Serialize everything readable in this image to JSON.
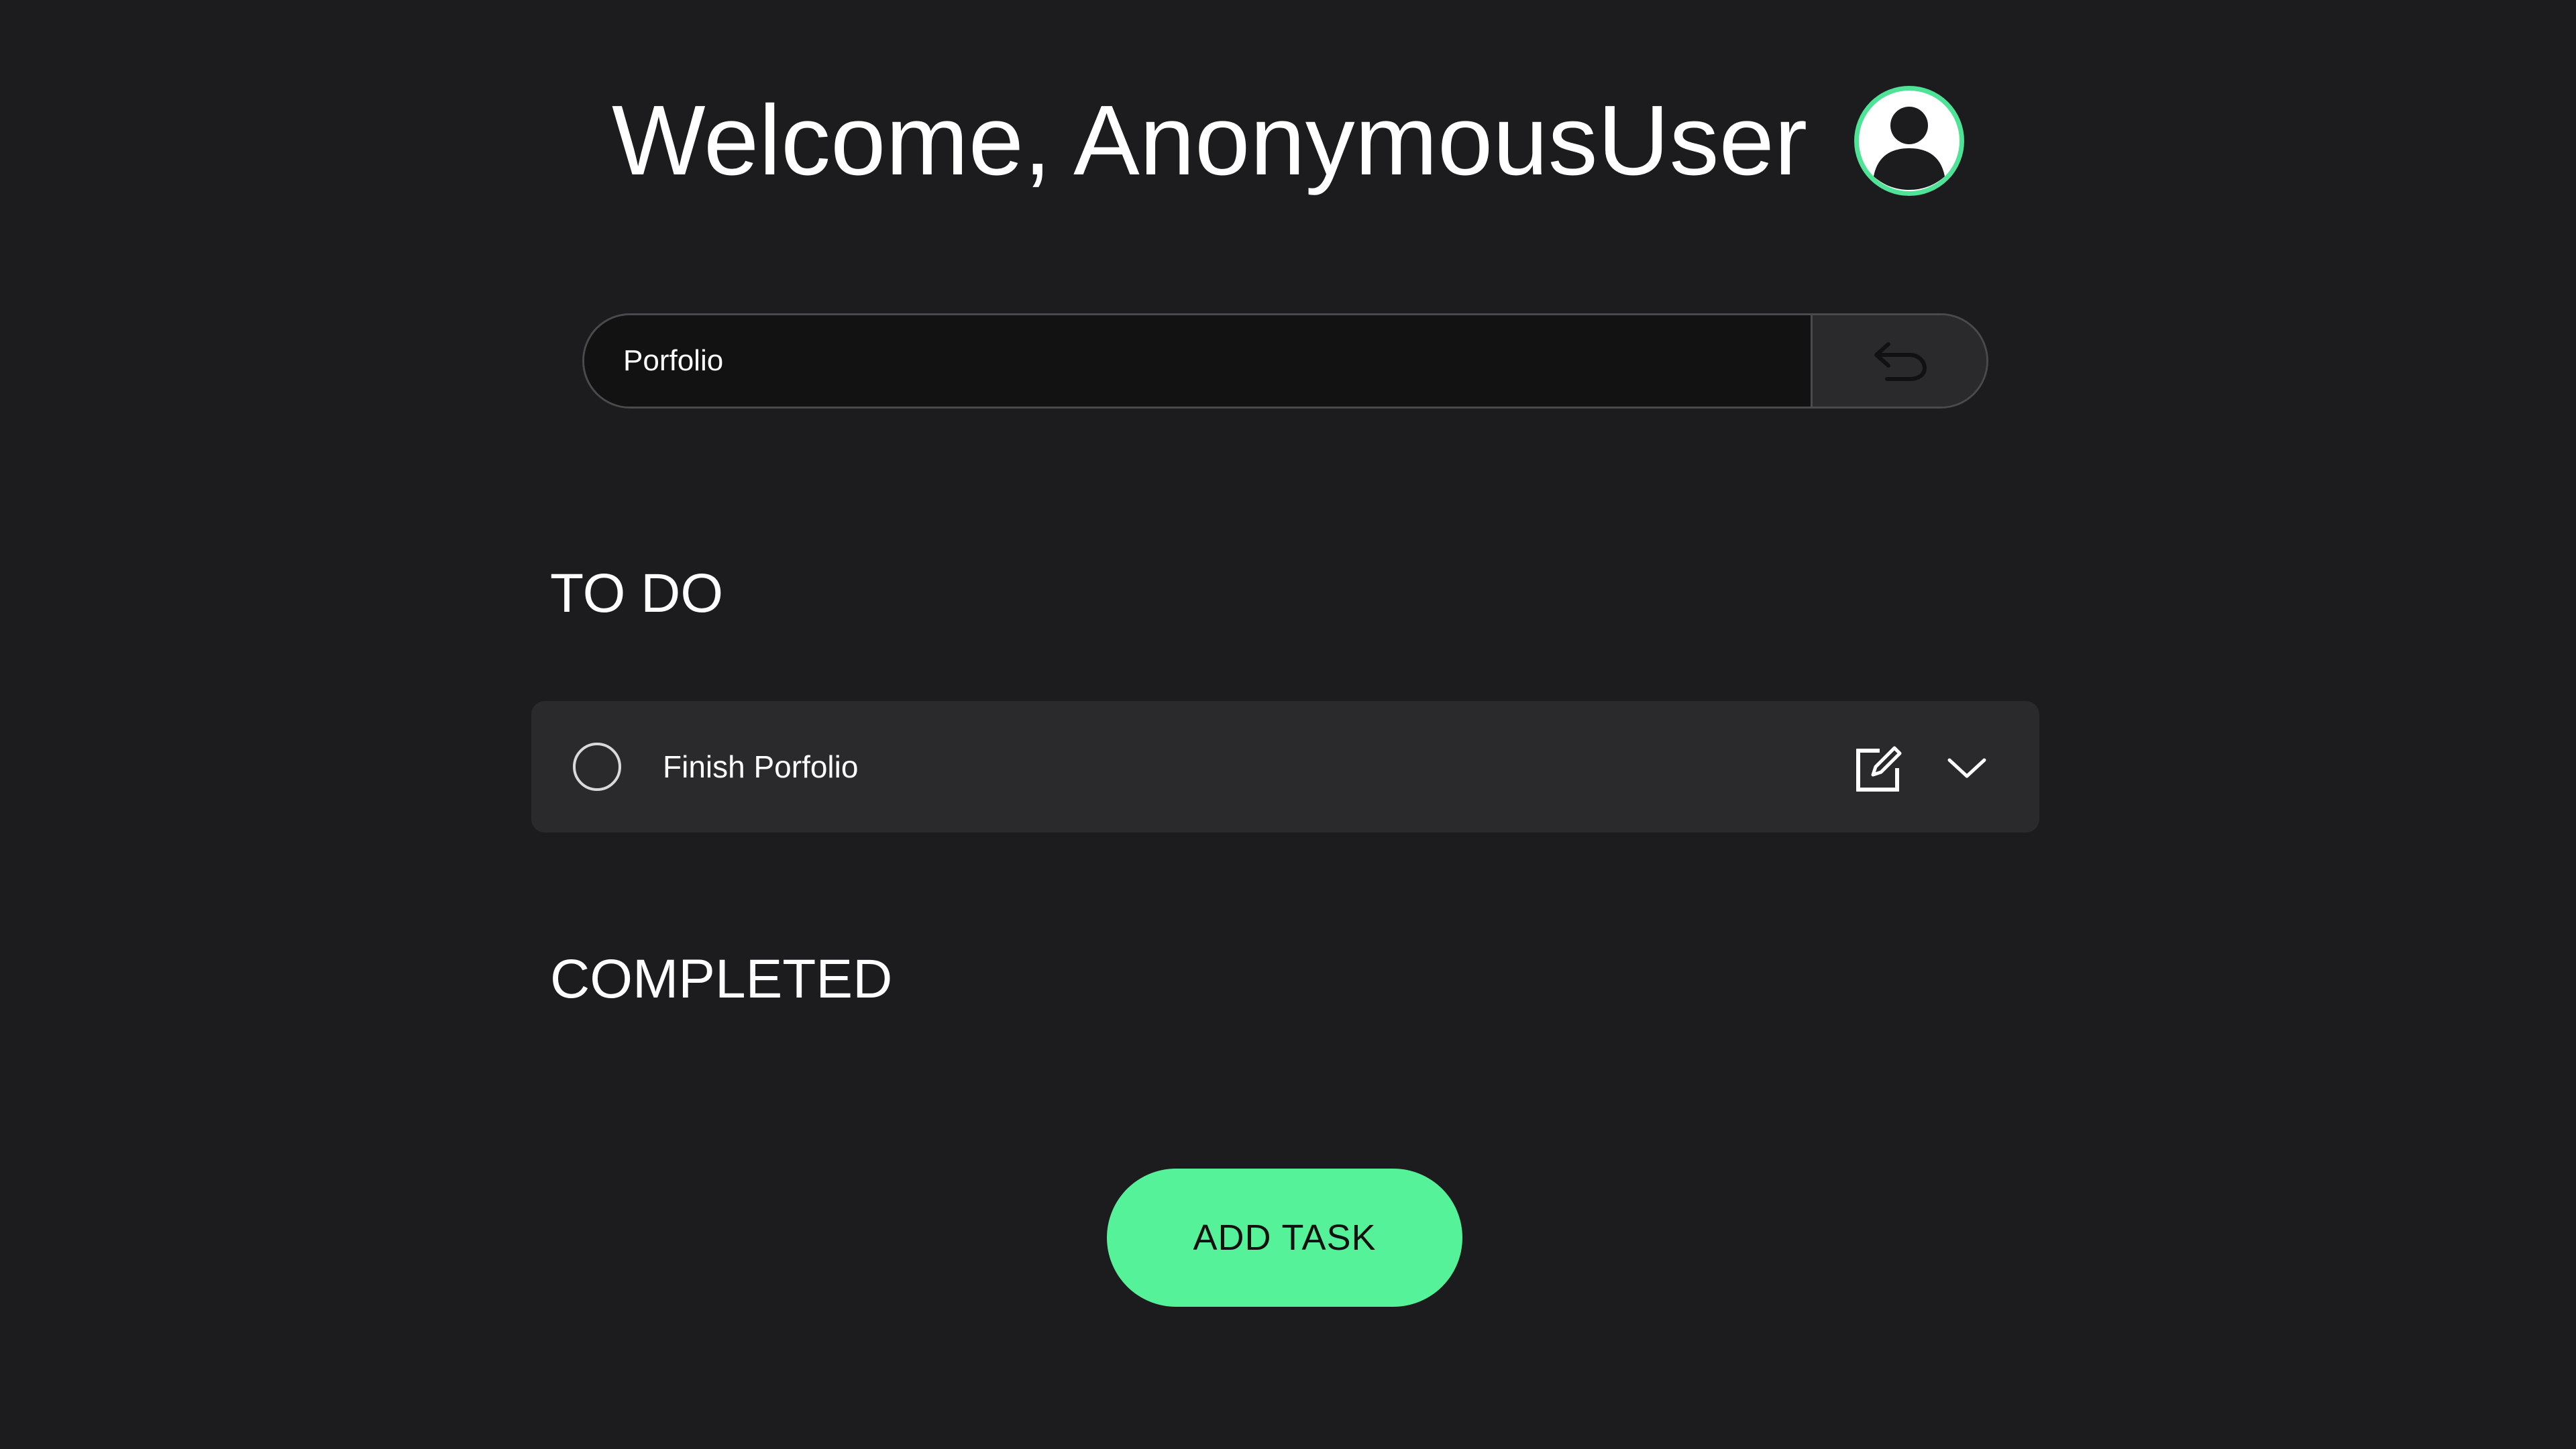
{
  "header": {
    "welcome_text": "Welcome, AnonymousUser",
    "avatar_icon": "user-avatar-icon",
    "avatar_ring_color": "#4ee396"
  },
  "search": {
    "value": "Porfolio",
    "placeholder": "",
    "back_icon": "undo-arrow-icon"
  },
  "sections": {
    "todo_title": "TO DO",
    "completed_title": "COMPLETED"
  },
  "tasks": {
    "todo": [
      {
        "label": "Finish Porfolio",
        "checkbox_icon": "circle-checkbox-icon",
        "edit_icon": "edit-icon",
        "expand_icon": "chevron-down-icon"
      }
    ],
    "completed": []
  },
  "actions": {
    "add_task_label": "ADD TASK"
  },
  "colors": {
    "background": "#1c1c1e",
    "card": "#2a2a2c",
    "accent": "#55f29a"
  }
}
